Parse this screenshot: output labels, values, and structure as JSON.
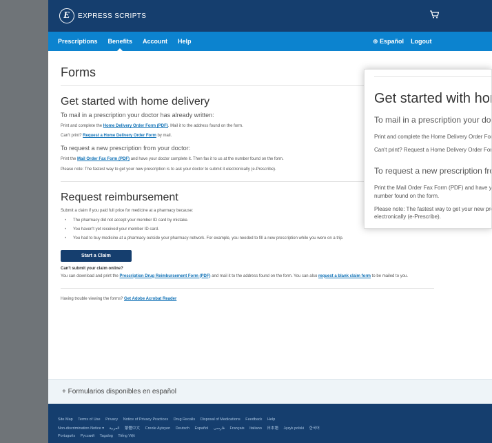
{
  "header": {
    "brand": "EXPRESS SCRIPTS",
    "logo_letter": "E",
    "cart_icon": "cart-icon"
  },
  "nav": {
    "items": [
      {
        "label": "Prescriptions"
      },
      {
        "label": "Benefits"
      },
      {
        "label": "Account"
      },
      {
        "label": "Help"
      }
    ],
    "active": "Benefits",
    "language": "⊕ Español",
    "logout": "Logout"
  },
  "page": {
    "title": "Forms"
  },
  "home_delivery": {
    "heading": "Get started with home delivery",
    "sub1": "To mail in a prescription your doctor has already written:",
    "p1_pre": "Print and complete the ",
    "p1_link": "Home Delivery Order Form (PDF)",
    "p1_post": ". Mail it to the address found on the form.",
    "p2_pre": "Can't print? ",
    "p2_link": "Request a Home Delivery Order Form",
    "p2_post": " by mail.",
    "sub2": "To request a new prescription from your doctor:",
    "p3_pre": "Print the ",
    "p3_link": "Mail Order Fax Form (PDF)",
    "p3_post": " and have your doctor complete it. Then fax it to us at the number found on the form.",
    "p4": "Please note: The fastest way to get your new prescription is to ask your doctor to submit it electronically (e-Prescribe)."
  },
  "reimbursement": {
    "heading": "Request reimbursement",
    "intro": "Submit a claim if you paid full price for medicine at a pharmacy because:",
    "reasons": [
      "The pharmacy did not accept your member ID card by mistake.",
      "You haven't yet received your member ID card.",
      "You had to buy medicine at a pharmacy outside your pharmacy network. For example, you needed to fill a new prescription while you were on a trip."
    ],
    "button": "Start a Claim",
    "q": "Can't submit your claim online?",
    "p_pre": "You can download and print the ",
    "p_link1": "Prescription Drug Reimbursement Form (PDF)",
    "p_mid": " and mail it to the address found on the form. You can also ",
    "p_link2": "request a blank claim form",
    "p_post": " to be mailed to you."
  },
  "trouble": {
    "pre": "Having trouble viewing the forms? ",
    "link": "Get Adobe Acrobat Reader"
  },
  "spanish_forms": "+ Formularios disponibles en español",
  "footer": {
    "links": [
      "Site Map",
      "Terms of Use",
      "Privacy",
      "Notice of Privacy Practices",
      "Drug Recalls",
      "Disposal of Medications",
      "Feedback",
      "Help"
    ],
    "languages_row1": [
      "Non-discrimination Notice ▾",
      "العربية",
      "繁體中文",
      "Creole Ayisyen",
      "Deutsch",
      "Español",
      "فارسی",
      "Français",
      "Italiano",
      "日本語",
      "Język polski",
      "한국어"
    ],
    "languages_row2": [
      "Português",
      "Русский",
      "Tagalog",
      "Tiếng Việt"
    ]
  },
  "zoom": {
    "heading": "Get started with home delivery",
    "sub1": "To mail in a prescription your doctor has already written:",
    "p1": "Print and complete the Home Delivery Order Form (PDF).",
    "p2": "Can't print? Request a Home Delivery Order Form by mail.",
    "sub2": "To request a new prescription from your doctor:",
    "p3": "Print the Mail Order Fax Form (PDF) and have your doctor complete it. Then fax it to us at the",
    "p3b": "number found on the form.",
    "p4": "Please note: The fastest way to get your new prescription is to ask your doctor to submit it",
    "p4b": "electronically (e-Prescribe)."
  }
}
